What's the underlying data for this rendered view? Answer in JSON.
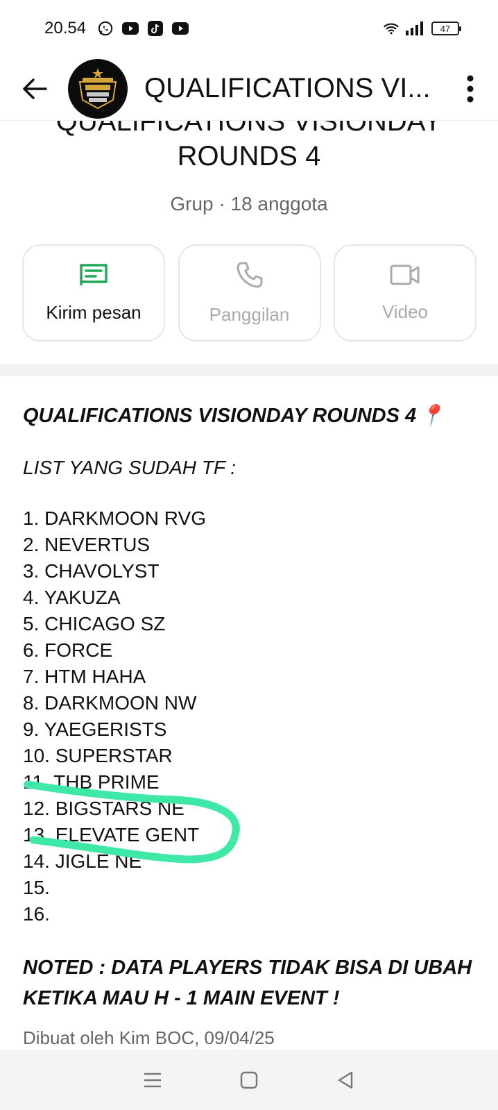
{
  "status": {
    "time": "20.54",
    "battery": "47",
    "icons": [
      "whatsapp-icon",
      "youtube-icon",
      "tiktok-icon",
      "youtube-icon",
      "wifi-icon",
      "signal-icon",
      "battery-icon"
    ]
  },
  "header": {
    "title": "QUALIFICATIONS VI...",
    "avatar_icon": "group-avatar-logo"
  },
  "group": {
    "name_line1": "QUALIFICATIONS VISIONDAY",
    "name_line2": "ROUNDS 4",
    "meta": "Grup · 18 anggota"
  },
  "actions": [
    {
      "label": "Kirim pesan",
      "icon": "message-icon",
      "enabled": true
    },
    {
      "label": "Panggilan",
      "icon": "phone-icon",
      "enabled": false
    },
    {
      "label": "Video",
      "icon": "video-icon",
      "enabled": false
    }
  ],
  "description": {
    "title": "QUALIFICATIONS VISIONDAY ROUNDS 4",
    "title_emoji": "📍",
    "subtitle": "LIST YANG SUDAH TF :",
    "teams": [
      "1. DARKMOON RVG",
      "2. NEVERTUS",
      "3. CHAVOLYST",
      "4. YAKUZA",
      "5. CHICAGO SZ",
      "6. FORCE",
      "7. HTM HAHA",
      "8. DARKMOON NW",
      "9. YAEGERISTS",
      "10. SUPERSTAR",
      "11. THB PRIME",
      "12. BIGSTARS NE",
      "13. ELEVATE GENT",
      "14. JIGLE NE",
      "15.",
      "16."
    ],
    "note_line1": "NOTED : DATA PLAYERS TIDAK BISA DI UBAH",
    "note_line2": "KETIKA MAU H - 1 MAIN EVENT !",
    "created": "Dibuat oleh Kim BOC, 09/04/25"
  },
  "colors": {
    "accent": "#1fa855",
    "highlight_stroke": "#3ee8a6",
    "muted": "#aaaaaa"
  },
  "nav": [
    "menu-icon",
    "home-icon",
    "back-triangle-icon"
  ]
}
